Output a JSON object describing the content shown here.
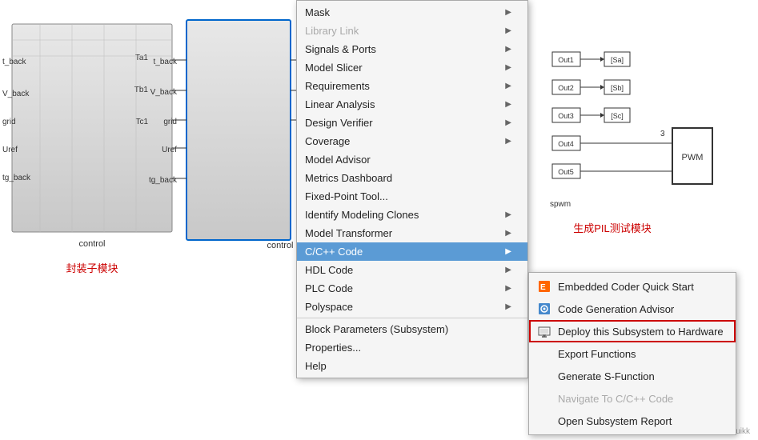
{
  "canvas": {
    "background": "#ffffff"
  },
  "model_left": {
    "block_name": "control",
    "subsystem_label": "封装子模块",
    "ports": [
      "t_back",
      "V_back",
      "grid",
      "Uref",
      "tg_back",
      "Ta1",
      "Tb1",
      "Tc1"
    ]
  },
  "model_right": {
    "pil_label": "生成PIL测试模块",
    "spwm_label": "spwm",
    "pwm_label": "PWM",
    "outputs": [
      "Out1",
      "Out2",
      "Out3",
      "Out4",
      "Out5"
    ],
    "goto_blocks": [
      "[Sa]",
      "[Sb]",
      "[Sc]"
    ]
  },
  "context_menu": {
    "items": [
      {
        "label": "Mask",
        "has_arrow": true,
        "disabled": false,
        "id": "mask"
      },
      {
        "label": "Library Link",
        "has_arrow": true,
        "disabled": true,
        "id": "library-link"
      },
      {
        "label": "Signals & Ports",
        "has_arrow": true,
        "disabled": false,
        "id": "signals-ports"
      },
      {
        "label": "Model Slicer",
        "has_arrow": true,
        "disabled": false,
        "id": "model-slicer"
      },
      {
        "label": "Requirements",
        "has_arrow": true,
        "disabled": false,
        "id": "requirements"
      },
      {
        "label": "Linear Analysis",
        "has_arrow": true,
        "disabled": false,
        "id": "linear-analysis"
      },
      {
        "label": "Design Verifier",
        "has_arrow": true,
        "disabled": false,
        "id": "design-verifier"
      },
      {
        "label": "Coverage",
        "has_arrow": true,
        "disabled": false,
        "id": "coverage"
      },
      {
        "label": "Model Advisor",
        "has_arrow": false,
        "disabled": false,
        "id": "model-advisor"
      },
      {
        "label": "Metrics Dashboard",
        "has_arrow": false,
        "disabled": false,
        "id": "metrics-dashboard"
      },
      {
        "label": "Fixed-Point Tool...",
        "has_arrow": false,
        "disabled": false,
        "id": "fixed-point-tool"
      },
      {
        "label": "Identify Modeling Clones",
        "has_arrow": true,
        "disabled": false,
        "id": "identify-clones"
      },
      {
        "label": "Model Transformer",
        "has_arrow": true,
        "disabled": false,
        "id": "model-transformer"
      },
      {
        "label": "C/C++ Code",
        "has_arrow": true,
        "disabled": false,
        "highlighted": true,
        "id": "cpp-code"
      },
      {
        "label": "HDL Code",
        "has_arrow": true,
        "disabled": false,
        "id": "hdl-code"
      },
      {
        "label": "PLC Code",
        "has_arrow": true,
        "disabled": false,
        "id": "plc-code"
      },
      {
        "label": "Polyspace",
        "has_arrow": true,
        "disabled": false,
        "id": "polyspace"
      },
      {
        "label": "Block Parameters (Subsystem)",
        "has_arrow": false,
        "disabled": false,
        "id": "block-params",
        "separator": true
      },
      {
        "label": "Properties...",
        "has_arrow": false,
        "disabled": false,
        "id": "properties"
      },
      {
        "label": "Help",
        "has_arrow": false,
        "disabled": false,
        "id": "help"
      }
    ]
  },
  "submenu": {
    "title": "C/C++ Code submenu",
    "items": [
      {
        "label": "Embedded Coder Quick Start",
        "has_arrow": false,
        "disabled": false,
        "id": "embedded-coder",
        "icon": "ec"
      },
      {
        "label": "Code Generation Advisor",
        "has_arrow": false,
        "disabled": false,
        "id": "code-gen-advisor",
        "icon": "cga"
      },
      {
        "label": "Deploy this Subsystem to Hardware",
        "has_arrow": false,
        "disabled": false,
        "highlighted_red": true,
        "id": "deploy-subsystem",
        "icon": "deploy"
      },
      {
        "label": "Export Functions",
        "has_arrow": false,
        "disabled": false,
        "id": "export-functions",
        "icon": ""
      },
      {
        "label": "Generate S-Function",
        "has_arrow": false,
        "disabled": false,
        "id": "generate-sfunction",
        "icon": ""
      },
      {
        "label": "Navigate To C/C++ Code",
        "has_arrow": false,
        "disabled": true,
        "id": "navigate-cpp",
        "icon": ""
      },
      {
        "label": "Open Subsystem Report",
        "has_arrow": false,
        "disabled": false,
        "id": "open-report",
        "icon": ""
      }
    ]
  },
  "watermark": {
    "text": "CSDN @Quikk"
  }
}
